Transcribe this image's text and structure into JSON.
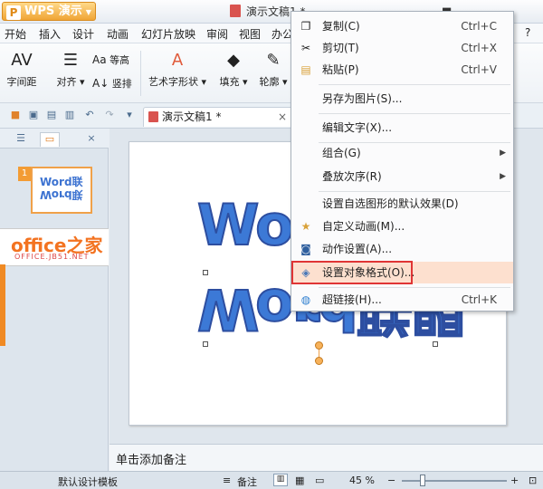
{
  "titlebar": {
    "app_name": "WPS 演示",
    "doc_title": "演示文稿1 *"
  },
  "menubar": [
    "开始",
    "插入",
    "设计",
    "动画",
    "幻灯片放映",
    "审阅",
    "视图",
    "办公"
  ],
  "menubar_help": "?",
  "ribbon": {
    "char_spacing": "字间距",
    "align": "对齐",
    "equal_height": "等高",
    "vertical": "竖排",
    "wordart_shape": "艺术字形状",
    "fill": "填充",
    "outline": "轮廓"
  },
  "tab": {
    "label": "演示文稿1 *"
  },
  "left_panel": {
    "slide_number": "1",
    "thumb_line1": "Word联",
    "thumb_line2": "Word联",
    "logo_main": "office之家",
    "logo_sub": "OFFICE.JB51.NET"
  },
  "slide": {
    "wordart_top": "Word",
    "wordart_bottom": "Word联盟"
  },
  "notes": {
    "placeholder": "单击添加备注"
  },
  "statusbar": {
    "template": "默认设计模板",
    "notes_label": "备注",
    "zoom": "45 %"
  },
  "context_menu": {
    "copy": {
      "label": "复制(C)",
      "shortcut": "Ctrl+C"
    },
    "cut": {
      "label": "剪切(T)",
      "shortcut": "Ctrl+X"
    },
    "paste": {
      "label": "粘贴(P)",
      "shortcut": "Ctrl+V"
    },
    "save_as_picture": {
      "label": "另存为图片(S)..."
    },
    "edit_text": {
      "label": "编辑文字(X)..."
    },
    "group": {
      "label": "组合(G)"
    },
    "order": {
      "label": "叠放次序(R)"
    },
    "set_default": {
      "label": "设置自选图形的默认效果(D)"
    },
    "custom_animation": {
      "label": "自定义动画(M)..."
    },
    "action_settings": {
      "label": "动作设置(A)..."
    },
    "format_object": {
      "label": "设置对象格式(O)..."
    },
    "hyperlink": {
      "label": "超链接(H)...",
      "shortcut": "Ctrl+K"
    }
  },
  "colors": {
    "accent_orange": "#f08a24",
    "highlight": "#fde0cf",
    "highlight_border": "#e03535",
    "wordart_blue": "#3c79d6"
  }
}
